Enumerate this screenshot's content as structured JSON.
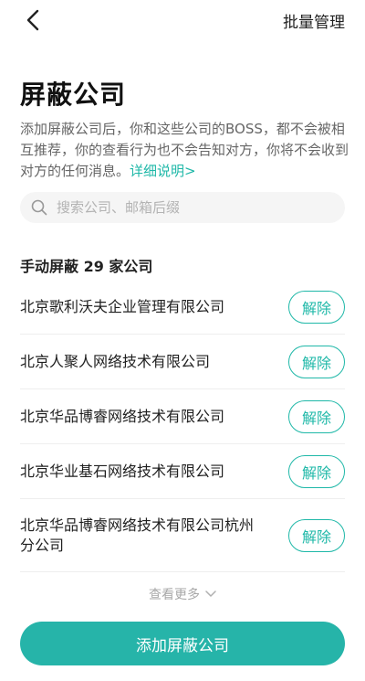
{
  "header": {
    "back_icon": "chevron-left-icon",
    "batch_manage_label": "批量管理"
  },
  "page": {
    "title": "屏蔽公司",
    "description": "添加屏蔽公司后，你和这些公司的BOSS，都不会被相互推荐，你的查看行为也不会告知对方，你将不会收到对方的任何消息。",
    "detail_link": "详细说明>"
  },
  "search": {
    "icon": "search-icon",
    "placeholder": "搜索公司、邮箱后缀"
  },
  "section": {
    "title": "手动屏蔽 29 家公司"
  },
  "companies": [
    {
      "name": "北京歌利沃夫企业管理有限公司",
      "action": "解除"
    },
    {
      "name": "北京人聚人网络技术有限公司",
      "action": "解除"
    },
    {
      "name": "北京华品博睿网络技术有限公司",
      "action": "解除"
    },
    {
      "name": "北京华业基石网络技术有限公司",
      "action": "解除"
    },
    {
      "name": "北京华品博睿网络技术有限公司杭州分公司",
      "action": "解除"
    }
  ],
  "footer": {
    "see_more_label": "查看更多",
    "see_more_icon": "chevron-down-icon",
    "add_button_label": "添加屏蔽公司"
  },
  "colors": {
    "accent": "#1fb8a8",
    "primary_button": "#26b4a9"
  }
}
